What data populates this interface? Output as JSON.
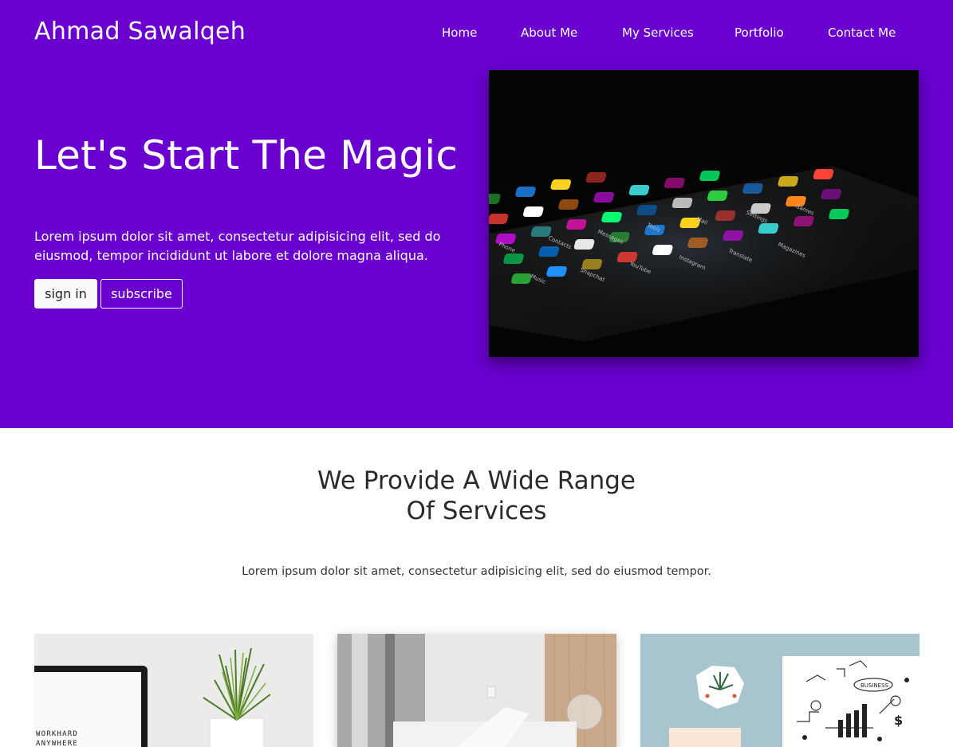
{
  "brand": "Ahmad Sawalqeh",
  "nav": [
    "Home",
    "About Me",
    "My Services",
    "Portfolio",
    "Contact Me"
  ],
  "hero": {
    "headline": "Let's Start The Magic",
    "lead": "Lorem ipsum dolor sit amet, consectetur adipisicing elit, sed do eiusmod, tempor incididunt ut labore et dolore magna aliqua.",
    "signin_label": "sign in",
    "subscribe_label": "subscribe",
    "image_app_labels": [
      "Phone",
      "Contacts",
      "Messages",
      "Tools",
      "Mail",
      "Settings",
      "Games",
      "Music",
      "Snapchat",
      "YouTube",
      "Instagram",
      "Translate",
      "Magazines"
    ]
  },
  "services": {
    "title_line1": "We Provide A Wide Range",
    "title_line2": "Of Services",
    "subtitle": "Lorem ipsum dolor sit amet, consectetur adipisicing elit, sed do eiusmod tempor.",
    "card1_image_text_line1": "WORKHARD",
    "card1_image_text_line2": "ANYWHERE",
    "card3_image_text": "BUSINESS"
  },
  "colors": {
    "hero_bg": "#6a00d0",
    "page_bg": "#ffffff",
    "text_dark": "#2a2a2a"
  }
}
